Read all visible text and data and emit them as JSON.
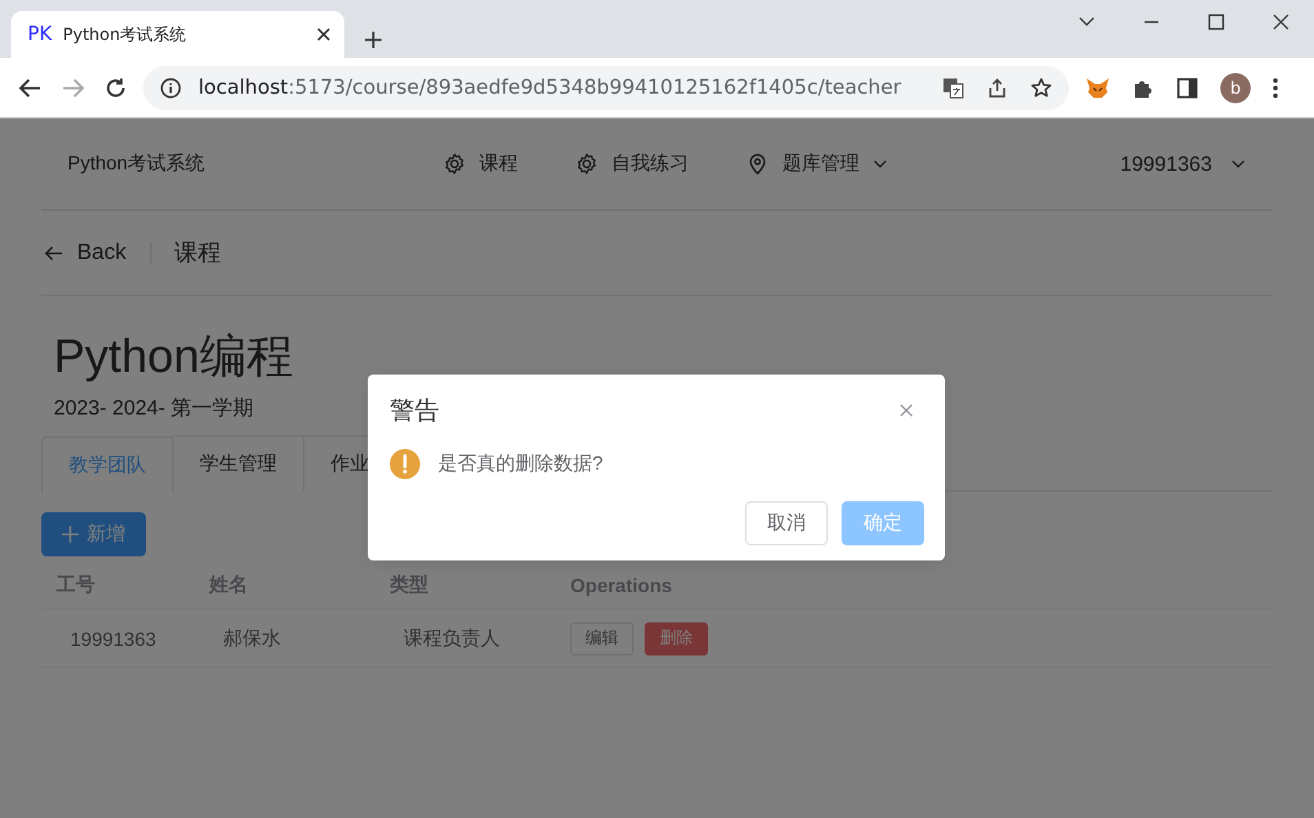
{
  "browser": {
    "tab_icon": "PK",
    "tab_title": "Python考试系统",
    "url_host": "localhost",
    "url_path": ":5173/course/893aedfe9d5348b99410125162f1405c/teacher",
    "avatar": "b"
  },
  "navbar": {
    "brand": "Python考试系统",
    "items": [
      {
        "label": "课程",
        "kind": "link"
      },
      {
        "label": "自我练习",
        "kind": "link"
      },
      {
        "label": "题库管理",
        "kind": "menu"
      }
    ],
    "user": "19991363"
  },
  "breadcrumb": {
    "back": "Back",
    "title": "课程"
  },
  "course": {
    "title": "Python编程",
    "term": "2023- 2024- 第一学期"
  },
  "tabs": [
    {
      "label": "教学团队",
      "selected": true
    },
    {
      "label": "学生管理",
      "selected": false
    },
    {
      "label": "作业",
      "selected": false
    }
  ],
  "add_button": "新增",
  "table": {
    "columns": [
      "工号",
      "姓名",
      "类型",
      "Operations"
    ],
    "rows": [
      {
        "cells": [
          "19991363",
          "郝保水",
          "课程负责人"
        ],
        "actions": [
          {
            "label": "编辑",
            "kind": "default"
          },
          {
            "label": "删除",
            "kind": "danger"
          }
        ]
      }
    ]
  },
  "dialog": {
    "title": "警告",
    "message": "是否真的删除数据?",
    "buttons": [
      {
        "label": "取消",
        "kind": "default"
      },
      {
        "label": "确定",
        "kind": "primary"
      }
    ]
  }
}
